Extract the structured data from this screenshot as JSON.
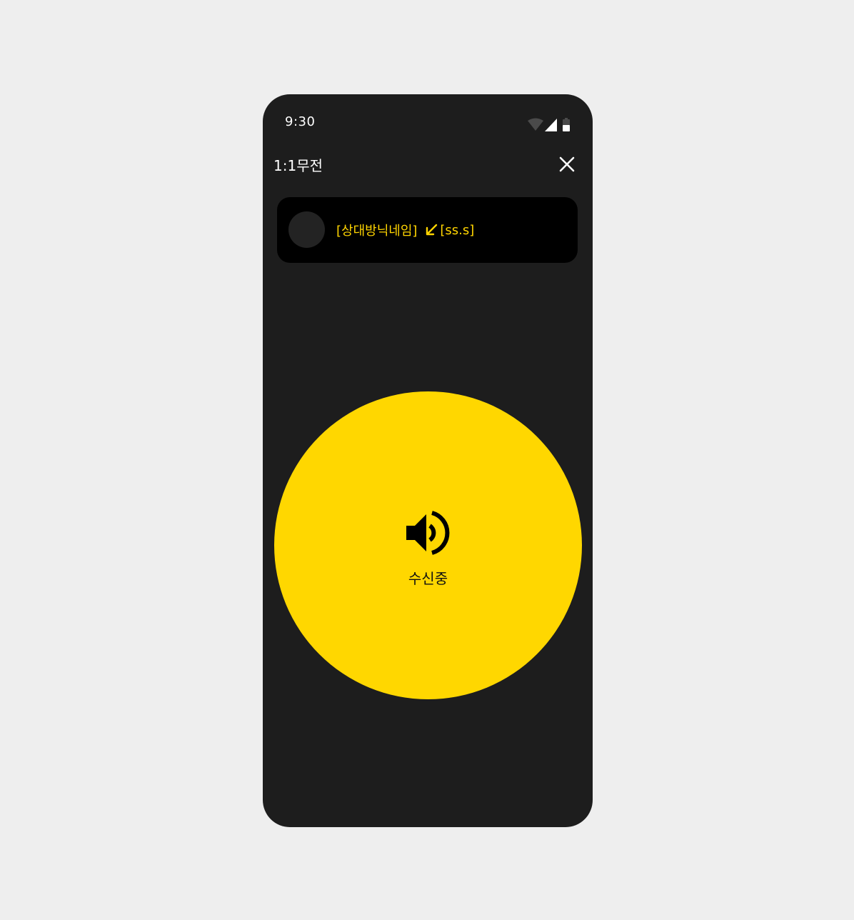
{
  "status_bar": {
    "time": "9:30",
    "icons": [
      "wifi-icon",
      "signal-icon",
      "battery-icon"
    ]
  },
  "header": {
    "title": "1:1무전",
    "close_icon": "close-icon"
  },
  "opponent": {
    "nickname": "[상대방닉네임]",
    "direction_icon": "arrow-down-left-icon",
    "time": "[ss.s]"
  },
  "receive_button": {
    "icon": "speaker-icon",
    "label": "수신중"
  },
  "colors": {
    "background": "#eeeeee",
    "phone": "#1d1d1d",
    "accent": "#ffd700",
    "card": "#000000"
  }
}
